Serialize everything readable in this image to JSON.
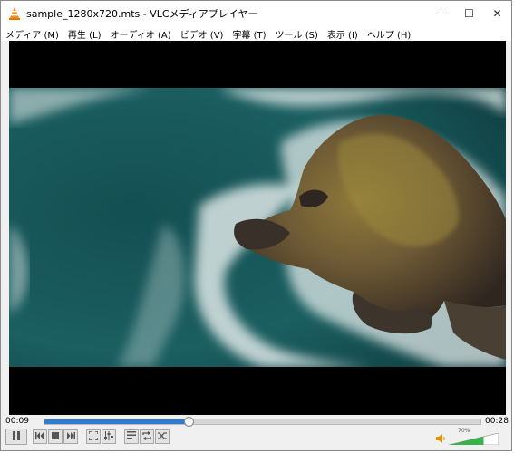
{
  "window": {
    "title": "sample_1280x720.mts - VLCメディアプレイヤー",
    "controls": {
      "minimize": "—",
      "maximize": "☐",
      "close": "✕"
    }
  },
  "menu": {
    "items": [
      "メディア (M)",
      "再生 (L)",
      "オーディオ (A)",
      "ビデオ (V)",
      "字幕 (T)",
      "ツール (S)",
      "表示 (I)",
      "ヘルプ (H)"
    ]
  },
  "player": {
    "elapsed": "00:09",
    "total": "00:28",
    "progress_fraction": 0.33,
    "volume_label": "70%",
    "volume_fraction": 0.7
  },
  "colors": {
    "seek_fill": "#2e7dd1",
    "volume_green": "#37b24d"
  },
  "icons": {
    "pause": "pause-icon",
    "prev": "skip-previous-icon",
    "stop": "stop-icon",
    "next": "skip-next-icon",
    "fullscreen": "fullscreen-icon",
    "extended": "extended-settings-icon",
    "playlist": "playlist-icon",
    "loop": "loop-icon",
    "shuffle": "shuffle-icon",
    "volume": "speaker-icon"
  }
}
